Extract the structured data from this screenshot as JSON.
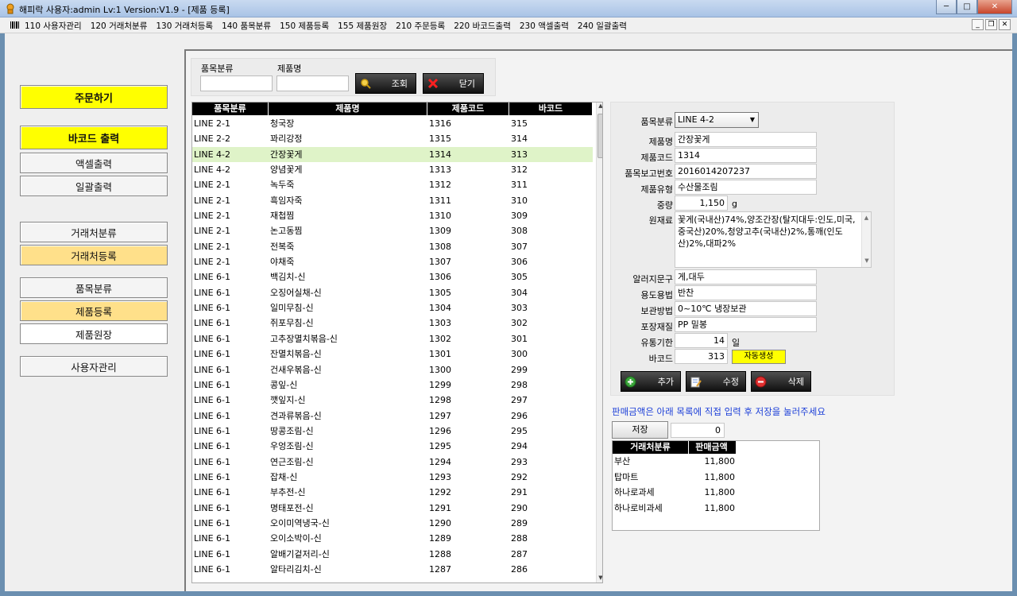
{
  "window": {
    "title": "해피락 사용자:admin Lv:1  Version:V1.9 - [제품 등록]",
    "min": "─",
    "max": "□",
    "close": "✕"
  },
  "menubar": {
    "items": [
      "110 사용자관리",
      "120 거래처분류",
      "130 거래처등록",
      "140 품목분류",
      "150 제품등록",
      "155 제품원장",
      "210 주문등록",
      "220 바코드출력",
      "230 액셀출력",
      "240 일괄출력"
    ],
    "mdi_min": "_",
    "mdi_restore": "❐",
    "mdi_close": "✕"
  },
  "sidebar": {
    "order": "주문하기",
    "barcode": "바코드 출력",
    "excel": "액셀출력",
    "batch": "일괄출력",
    "client_category": "거래처분류",
    "client_register": "거래처등록",
    "item_category": "품목분류",
    "product_register": "제품등록",
    "product_ledger": "제품원장",
    "user_admin": "사용자관리"
  },
  "search": {
    "category_label": "품목분류",
    "name_label": "제품명",
    "category_value": "",
    "name_value": "",
    "search_btn": "조회",
    "close_btn": "닫기"
  },
  "grid": {
    "headers": [
      "품목분류",
      "제품명",
      "제품코드",
      "바코드"
    ],
    "selected_index": 2,
    "rows": [
      [
        "LINE 2-1",
        "청국장",
        "1316",
        "315"
      ],
      [
        "LINE 2-2",
        "꽈리강정",
        "1315",
        "314"
      ],
      [
        "LINE 4-2",
        "간장꽃게",
        "1314",
        "313"
      ],
      [
        "LINE 4-2",
        "양념꽃게",
        "1313",
        "312"
      ],
      [
        "LINE 2-1",
        "녹두죽",
        "1312",
        "311"
      ],
      [
        "LINE 2-1",
        "흑임자죽",
        "1311",
        "310"
      ],
      [
        "LINE 2-1",
        "재첩찜",
        "1310",
        "309"
      ],
      [
        "LINE 2-1",
        "논고동찜",
        "1309",
        "308"
      ],
      [
        "LINE 2-1",
        "전복죽",
        "1308",
        "307"
      ],
      [
        "LINE 2-1",
        "야채죽",
        "1307",
        "306"
      ],
      [
        "LINE 6-1",
        "백김치-신",
        "1306",
        "305"
      ],
      [
        "LINE 6-1",
        "오징어실채-신",
        "1305",
        "304"
      ],
      [
        "LINE 6-1",
        "일미무침-신",
        "1304",
        "303"
      ],
      [
        "LINE 6-1",
        "쥐포무침-신",
        "1303",
        "302"
      ],
      [
        "LINE 6-1",
        "고추장멸치볶음-신",
        "1302",
        "301"
      ],
      [
        "LINE 6-1",
        "잔멸치볶음-신",
        "1301",
        "300"
      ],
      [
        "LINE 6-1",
        "건새우볶음-신",
        "1300",
        "299"
      ],
      [
        "LINE 6-1",
        "콩잎-신",
        "1299",
        "298"
      ],
      [
        "LINE 6-1",
        "깻잎지-신",
        "1298",
        "297"
      ],
      [
        "LINE 6-1",
        "견과류볶음-신",
        "1297",
        "296"
      ],
      [
        "LINE 6-1",
        "땅콩조림-신",
        "1296",
        "295"
      ],
      [
        "LINE 6-1",
        "우엉조림-신",
        "1295",
        "294"
      ],
      [
        "LINE 6-1",
        "연근조림-신",
        "1294",
        "293"
      ],
      [
        "LINE 6-1",
        "잡채-신",
        "1293",
        "292"
      ],
      [
        "LINE 6-1",
        "부추전-신",
        "1292",
        "291"
      ],
      [
        "LINE 6-1",
        "명태포전-신",
        "1291",
        "290"
      ],
      [
        "LINE 6-1",
        "오이미역냉국-신",
        "1290",
        "289"
      ],
      [
        "LINE 6-1",
        "오이소박이-신",
        "1289",
        "288"
      ],
      [
        "LINE 6-1",
        "알배기겉저리-신",
        "1288",
        "287"
      ],
      [
        "LINE 6-1",
        "알타리김치-신",
        "1287",
        "286"
      ]
    ]
  },
  "detail": {
    "category_label": "품목분류",
    "category_value": "LINE 4-2",
    "name_label": "제품명",
    "name_value": "간장꽃게",
    "code_label": "제품코드",
    "code_value": "1314",
    "report_label": "품목보고번호",
    "report_value": "2016014207237",
    "type_label": "제품유형",
    "type_value": "수산물조림",
    "weight_label": "중량",
    "weight_value": "1,150",
    "weight_unit": "g",
    "ingredients_label": "원재료",
    "ingredients_value": "꽃게(국내산)74%,양조간장(탈지대두:인도,미국,중국산)20%,청양고추(국내산)2%,통깨(인도산)2%,대파2%",
    "allergen_label": "알러지문구",
    "allergen_value": "게,대두",
    "usage_label": "용도용법",
    "usage_value": "반찬",
    "storage_label": "보관방법",
    "storage_value": "0~10℃ 냉장보관",
    "package_label": "포장재질",
    "package_value": "PP 밀봉",
    "shelf_label": "유통기한",
    "shelf_value": "14",
    "shelf_unit": "일",
    "barcode_label": "바코드",
    "barcode_value": "313",
    "auto_btn": "자동생성",
    "add_btn": "추가",
    "edit_btn": "수정",
    "delete_btn": "삭제"
  },
  "pricing": {
    "hint": "판매금액은 아래 목록에 직접 입력 후 저장을 눌러주세요",
    "save_btn": "저장",
    "save_value": "0",
    "headers": [
      "거래처분류",
      "판매금액"
    ],
    "rows": [
      [
        "부산",
        "11,800"
      ],
      [
        "탑마트",
        "11,800"
      ],
      [
        "하나로과세",
        "11,800"
      ],
      [
        "하나로비과세",
        "11,800"
      ]
    ]
  },
  "colors": {
    "accent_yellow": "#ffff00",
    "accent_orange": "#ffe08a",
    "selected_row": "#dff3c8",
    "hint_blue": "#1c3fd8"
  }
}
